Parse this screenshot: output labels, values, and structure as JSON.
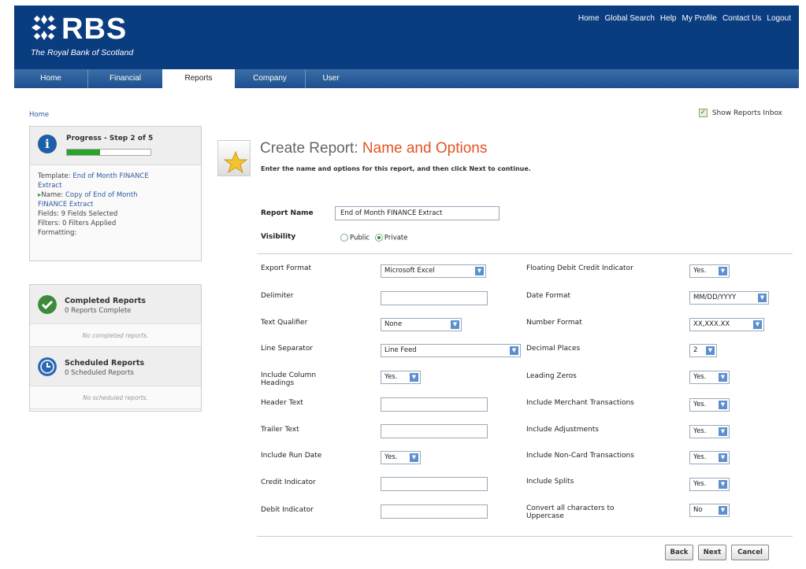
{
  "header": {
    "logo_text": "RBS",
    "logo_subtitle": "The Royal Bank of Scotland",
    "top_links": [
      "Home",
      "Global Search",
      "Help",
      "My Profile",
      "Contact Us",
      "Logout"
    ]
  },
  "nav": {
    "tabs": [
      "Home",
      "Financial",
      "Reports",
      "Company",
      "User"
    ],
    "active": "Reports"
  },
  "breadcrumb": "Home",
  "show_reports_inbox": {
    "label": "Show Reports Inbox",
    "checked": true
  },
  "progress": {
    "title": "Progress - Step 2 of 5",
    "fraction": 0.4,
    "steps": {
      "template_label": "Template:",
      "template_value_1": "End of Month FINANCE",
      "template_value_2": "Extract",
      "name_label": "Name:",
      "name_value_1": "Copy of End of Month",
      "name_value_2": "FINANCE Extract",
      "fields": "Fields: 9 Fields Selected",
      "filters": "Filters: 0 Filters Applied",
      "formatting": "Formatting:"
    }
  },
  "completed": {
    "title": "Completed Reports",
    "sub": "0 Reports Complete",
    "empty": "No completed reports."
  },
  "scheduled": {
    "title": "Scheduled Reports",
    "sub": "0 Scheduled Reports",
    "empty": "No scheduled reports."
  },
  "main": {
    "title_prefix": "Create Report:",
    "title_accent": "Name and Options",
    "description": "Enter the name and options for this report, and then click Next to continue."
  },
  "form": {
    "report_name_label": "Report Name",
    "report_name_value": "End of Month FINANCE Extract",
    "visibility_label": "Visibility",
    "visibility_public": "Public",
    "visibility_private": "Private",
    "left": {
      "export_format": {
        "label": "Export Format",
        "value": "Microsoft Excel"
      },
      "delimiter": {
        "label": "Delimiter",
        "value": ""
      },
      "text_qualifier": {
        "label": "Text Qualifier",
        "value": "None"
      },
      "line_separator": {
        "label": "Line Separator",
        "value": "Line Feed"
      },
      "include_column_headings": {
        "label_1": "Include Column",
        "label_2": "Headings",
        "value": "Yes."
      },
      "header_text": {
        "label": "Header Text",
        "value": ""
      },
      "trailer_text": {
        "label": "Trailer Text",
        "value": ""
      },
      "include_run_date": {
        "label": "Include Run Date",
        "value": "Yes."
      },
      "credit_indicator": {
        "label": "Credit Indicator",
        "value": ""
      },
      "debit_indicator": {
        "label": "Debit Indicator",
        "value": ""
      }
    },
    "right": {
      "floating_debit_credit": {
        "label": "Floating Debit Credit Indicator",
        "value": "Yes."
      },
      "date_format": {
        "label": "Date Format",
        "value": "MM/DD/YYYY"
      },
      "number_format": {
        "label": "Number Format",
        "value": "XX,XXX.XX"
      },
      "decimal_places": {
        "label": "Decimal Places",
        "value": "2"
      },
      "leading_zeros": {
        "label": "Leading Zeros",
        "value": "Yes."
      },
      "include_merchant_transactions": {
        "label": "Include Merchant Transactions",
        "value": "Yes."
      },
      "include_adjustments": {
        "label": "Include Adjustments",
        "value": "Yes."
      },
      "include_non_card_transactions": {
        "label": "Include Non-Card Transactions",
        "value": "Yes."
      },
      "include_splits": {
        "label": "Include Splits",
        "value": "Yes."
      },
      "convert_uppercase": {
        "label_1": "Convert all characters to",
        "label_2": "Uppercase",
        "value": "No"
      }
    }
  },
  "buttons": {
    "back": "Back",
    "next": "Next",
    "cancel": "Cancel"
  },
  "colors": {
    "brand": "#0a3d80",
    "accent": "#e15422",
    "progress": "#2aa32a"
  }
}
